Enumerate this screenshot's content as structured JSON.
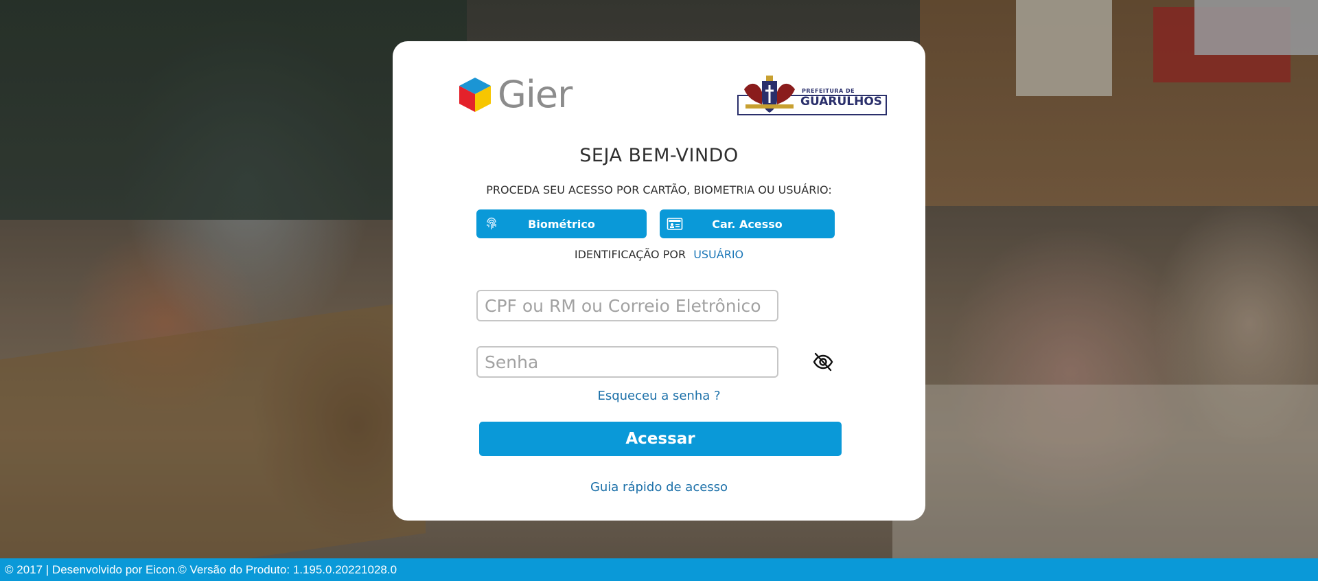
{
  "brand": {
    "product_name": "Gier",
    "city_logo_small": "PREFEITURA DE",
    "city_logo_big": "GUARULHOS",
    "colors": {
      "primary_blue": "#0a99d8",
      "link_blue": "#1a6fa8",
      "cube_red": "#e4222b",
      "cube_yellow": "#f7c600",
      "cube_blue": "#1b95d4"
    }
  },
  "login": {
    "title": "SEJA BEM-VINDO",
    "subtitle": "PROCEDA SEU ACESSO POR CARTÃO, BIOMETRIA OU USUÁRIO:",
    "biometric_button": {
      "label": "Biométrico",
      "icon": "fingerprint-icon"
    },
    "card_button": {
      "label": "Car. Acesso",
      "icon": "id-card-icon"
    },
    "identification_prefix": "IDENTIFICAÇÃO POR",
    "identification_link": "USUÁRIO",
    "username_placeholder": "CPF ou RM ou Correio Eletrônico",
    "username_value": "",
    "password_placeholder": "Senha",
    "password_value": "",
    "password_toggle_icon": "eye-slash-icon",
    "forgot_password": "Esqueceu a senha ?",
    "submit_label": "Acessar",
    "quick_guide": "Guia rápido de acesso"
  },
  "footer": {
    "text": "© 2017 | Desenvolvido por Eicon.© Versão do Produto: 1.195.0.20221028.0"
  }
}
